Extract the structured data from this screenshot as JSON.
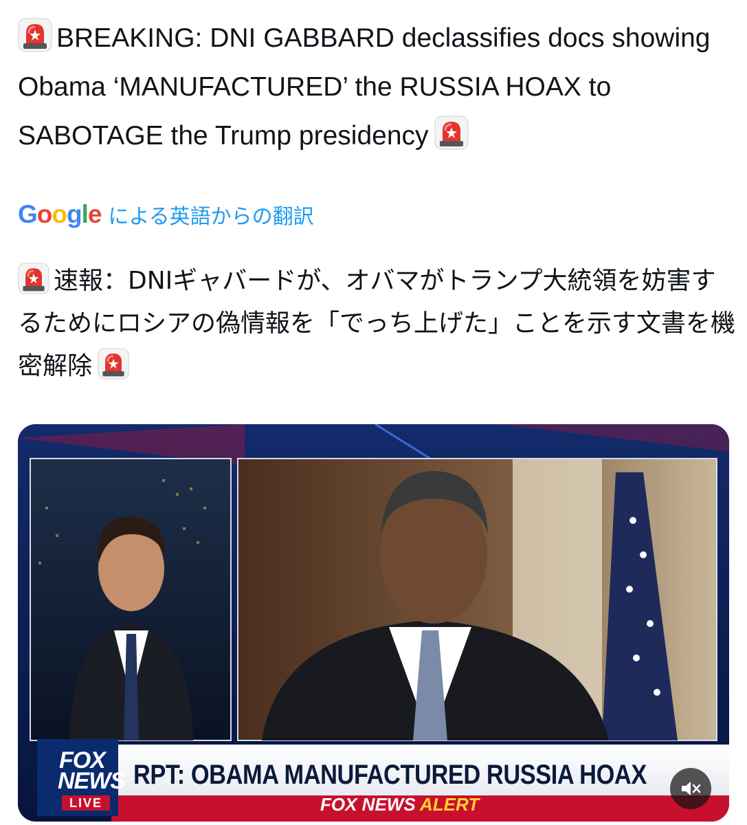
{
  "post": {
    "text": "BREAKING: DNI GABBARD declassifies docs showing Obama ‘MANUFACTURED’ the RUSSIA HOAX to SABOTAGE the Trump presidency",
    "emoji_icon": "rotating-light-icon"
  },
  "translation": {
    "provider_letters": [
      "G",
      "o",
      "o",
      "g",
      "l",
      "e"
    ],
    "provider_colors": [
      "#4285f4",
      "#ea4335",
      "#fbbc05",
      "#4285f4",
      "#34a853",
      "#ea4335"
    ],
    "label": "による英語からの翻訳",
    "text": "速報：DNIギャバードが、オバマがトランプ大統領を妨害するためにロシアの偽情報を「でっち上げた」ことを示す文書を機密解除"
  },
  "media": {
    "chyron": "RPT: OBAMA MANUFACTURED RUSSIA HOAX",
    "alert_prefix": "FOX NEWS",
    "alert_word": "ALERT",
    "logo_fox": "FOX",
    "logo_news": "NEWS",
    "logo_live": "LIVE",
    "mute_icon": "speaker-muted-icon"
  },
  "colors": {
    "link_blue": "#1d9bf0",
    "text": "#0f1419",
    "chyron_red": "#c8102e",
    "alert_yellow": "#ffd22e",
    "broadcast_blue": "#0a1a4a"
  }
}
